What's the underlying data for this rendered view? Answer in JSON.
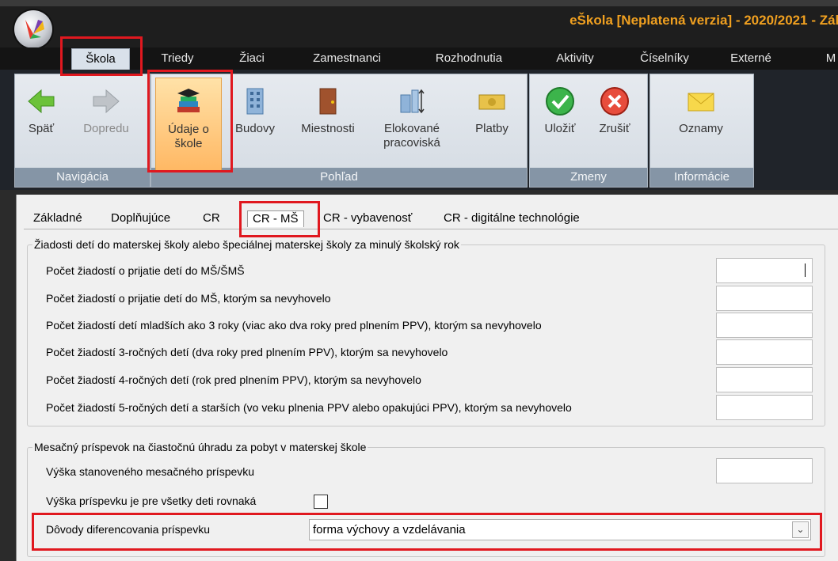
{
  "window": {
    "title": "eŠkola [Neplatená verzia] - 2020/2021 - Zák"
  },
  "ribbon_tabs": [
    "Škola",
    "Triedy",
    "Žiaci",
    "Zamestnanci",
    "Rozhodnutia",
    "Aktivity",
    "Číselníky",
    "Externé",
    "M"
  ],
  "ribbon_groups": {
    "navigacia": {
      "label": "Navigácia",
      "buttons": [
        "Späť",
        "Dopredu"
      ]
    },
    "pohlad": {
      "label": "Pohľad",
      "buttons": [
        "Údaje o",
        "škole",
        "Budovy",
        "Miestnosti",
        "Elokované",
        "pracoviská",
        "Platby"
      ]
    },
    "zmeny": {
      "label": "Zmeny",
      "buttons": [
        "Uložiť",
        "Zrušiť"
      ]
    },
    "informacie": {
      "label": "Informácie",
      "buttons": [
        "Oznamy"
      ]
    }
  },
  "content_tabs": [
    "Základné",
    "Doplňujúce",
    "CR",
    "CR - MŠ",
    "CR - vybavenosť",
    "CR - digitálne technológie"
  ],
  "section1": {
    "legend": "Žiadosti detí do materskej školy alebo špeciálnej materskej školy za minulý školský rok",
    "rows": [
      "Počet žiadostí o prijatie detí do MŠ/ŠMŠ",
      "Počet žiadostí o prijatie detí do MŠ, ktorým sa nevyhovelo",
      "Počet žiadostí detí mladších ako 3 roky (viac ako dva roky pred plnením PPV), ktorým sa nevyhovelo",
      "Počet žiadostí 3-ročných detí (dva roky pred plnením PPV), ktorým sa nevyhovelo",
      "Počet žiadostí 4-ročných detí (rok pred plnením PPV), ktorým sa nevyhovelo",
      "Počet žiadostí 5-ročných detí a starších (vo veku plnenia PPV alebo opakujúci PPV), ktorým sa nevyhovelo"
    ]
  },
  "section2": {
    "legend": "Mesačný príspevok na čiastočnú úhradu za pobyt v materskej škole",
    "amount_label": "Výška stanoveného mesačného príspevku",
    "same_for_all_label": "Výška príspevku je pre všetky deti rovnaká",
    "same_for_all_checked": false,
    "reasons_label": "Dôvody diferencovania príspevku",
    "reasons_value": "forma výchovy a vzdelávania"
  },
  "colors": {
    "highlight": "#e0181f",
    "title_text": "#f0a020",
    "ribbon_group_label": "#8595a6"
  }
}
